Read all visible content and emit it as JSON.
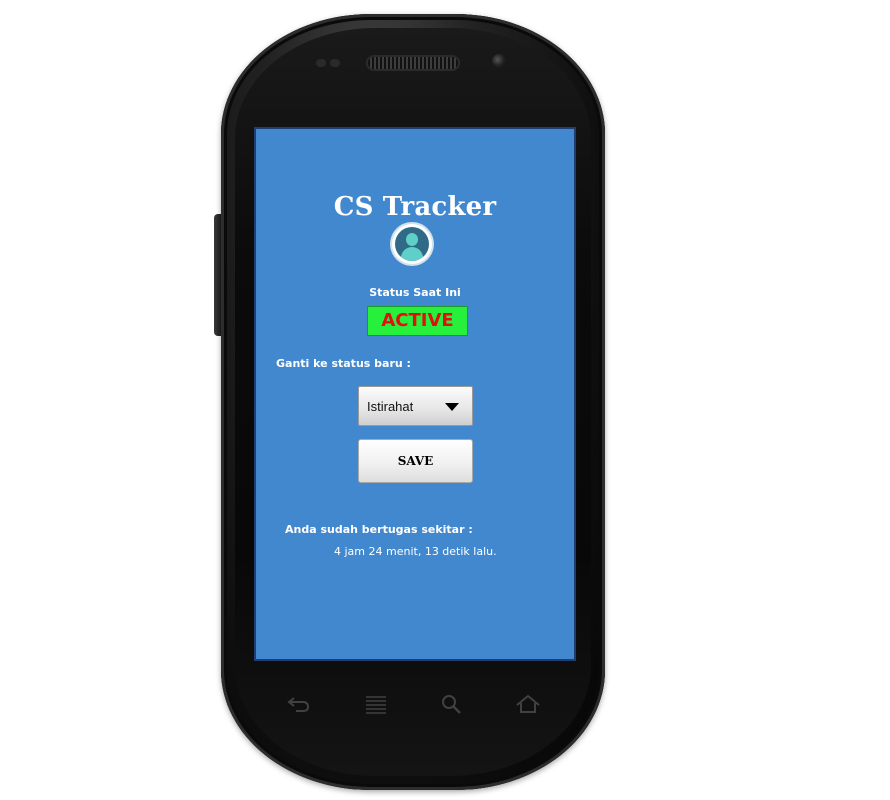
{
  "app": {
    "title": "CS Tracker",
    "avatar_icon": "customer-service-agent-icon"
  },
  "status": {
    "label": "Status Saat Ini",
    "current": "ACTIVE",
    "badge_bg": "#26f03b",
    "badge_fg": "#e01010"
  },
  "change_status": {
    "label": "Ganti ke status baru :",
    "selected": "Istirahat",
    "save_label": "SAVE"
  },
  "duty": {
    "label": "Anda sudah bertugas sekitar :",
    "value": "4 jam 24 menit, 13 detik lalu."
  },
  "theme": {
    "screen_bg": "#4288cf"
  },
  "device": {
    "nav_keys": [
      "back-icon",
      "menu-icon",
      "search-icon",
      "home-icon"
    ]
  }
}
